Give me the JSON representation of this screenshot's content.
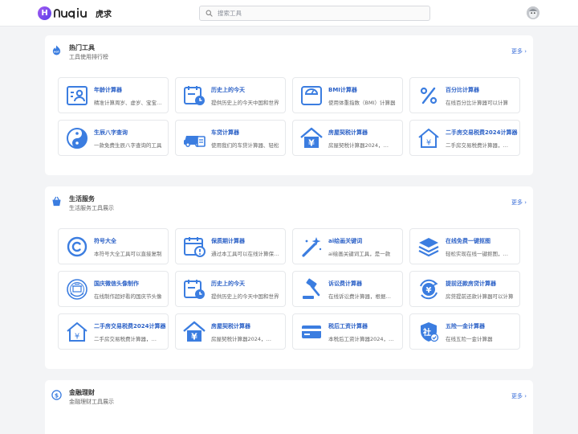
{
  "header": {
    "logo_mark": "H",
    "logo_word": "nuqiu",
    "logo_cn": "虎求",
    "search_placeholder": "搜索工具"
  },
  "sections": [
    {
      "title": "热门工具",
      "subtitle": "工具使用排行榜",
      "more": "更多 ›",
      "icon": "hot-flame-icon",
      "cards": [
        {
          "title": "年龄计算器",
          "desc": "精准计算周岁、虚岁、宝宝月龄",
          "icon": "person-card-icon"
        },
        {
          "title": "历史上的今天",
          "desc": "提供历史上的今天中国和世界",
          "icon": "calendar-clock-icon"
        },
        {
          "title": "BMI计算器",
          "desc": "使用体重指数（BMI）计算器",
          "icon": "scale-icon"
        },
        {
          "title": "百分比计算器",
          "desc": "在线百分比计算器可以计算",
          "icon": "percent-icon"
        },
        {
          "title": "生辰八字查询",
          "desc": "一款免费生辰八字查询的工具",
          "icon": "yin-yang-icon"
        },
        {
          "title": "车贷计算器",
          "desc": "使用我们的车贷计算器、轻松",
          "icon": "car-calculator-icon"
        },
        {
          "title": "房屋契税计算器",
          "desc": "房屋契税计算器2024，…",
          "icon": "house-yuan-icon"
        },
        {
          "title": "二手房交易税费2024计算器",
          "desc": "二手房交易税费计算器，…",
          "icon": "house-yuan-outline-icon"
        }
      ]
    },
    {
      "title": "生活服务",
      "subtitle": "生活服务工具展示",
      "more": "更多 ›",
      "icon": "shopping-basket-icon",
      "cards": [
        {
          "title": "符号大全",
          "desc": "本符号大全工具可以直接复制",
          "icon": "copyright-symbol-icon"
        },
        {
          "title": "保质期计算器",
          "desc": "通过本工具可以在线计算保质期",
          "icon": "calendar-alert-icon"
        },
        {
          "title": "ai绘画关键词",
          "desc": "ai绘画关键词工具，是一款",
          "icon": "magic-wand-icon"
        },
        {
          "title": "在线免费一键抠图",
          "desc": "轻松实现在线一键抠图，…",
          "icon": "layers-icon"
        },
        {
          "title": "国庆微信头像制作",
          "desc": "在线制作超好看的国庆节头像",
          "icon": "emblem-avatar-icon"
        },
        {
          "title": "历史上的今天",
          "desc": "提供历史上的今天中国和世界",
          "icon": "calendar-clock-icon"
        },
        {
          "title": "诉讼费计算器",
          "desc": "在线诉讼费计算器，根据…",
          "icon": "gavel-icon"
        },
        {
          "title": "提前还款房贷计算器",
          "desc": "房贷提前还款计算器可以计算",
          "icon": "money-refresh-icon"
        },
        {
          "title": "二手房交易税费2024计算器",
          "desc": "二手房交易税费计算器，…",
          "icon": "house-yuan-outline-icon"
        },
        {
          "title": "房屋契税计算器",
          "desc": "房屋契税计算器2024，…",
          "icon": "house-yuan-icon"
        },
        {
          "title": "税后工资计算器",
          "desc": "本税后工资计算器2024，…",
          "icon": "credit-card-icon"
        },
        {
          "title": "五险一金计算器",
          "desc": "在线五险一金计算器",
          "icon": "social-security-shield-icon"
        }
      ]
    },
    {
      "title": "金融理财",
      "subtitle": "金融理财工具展示",
      "more": "更多 ›",
      "icon": "dollar-circle-icon",
      "cards": []
    }
  ],
  "colors": {
    "accent": "#2d62c7",
    "icon": "#3b7de0",
    "background": "#f3f4f6"
  }
}
